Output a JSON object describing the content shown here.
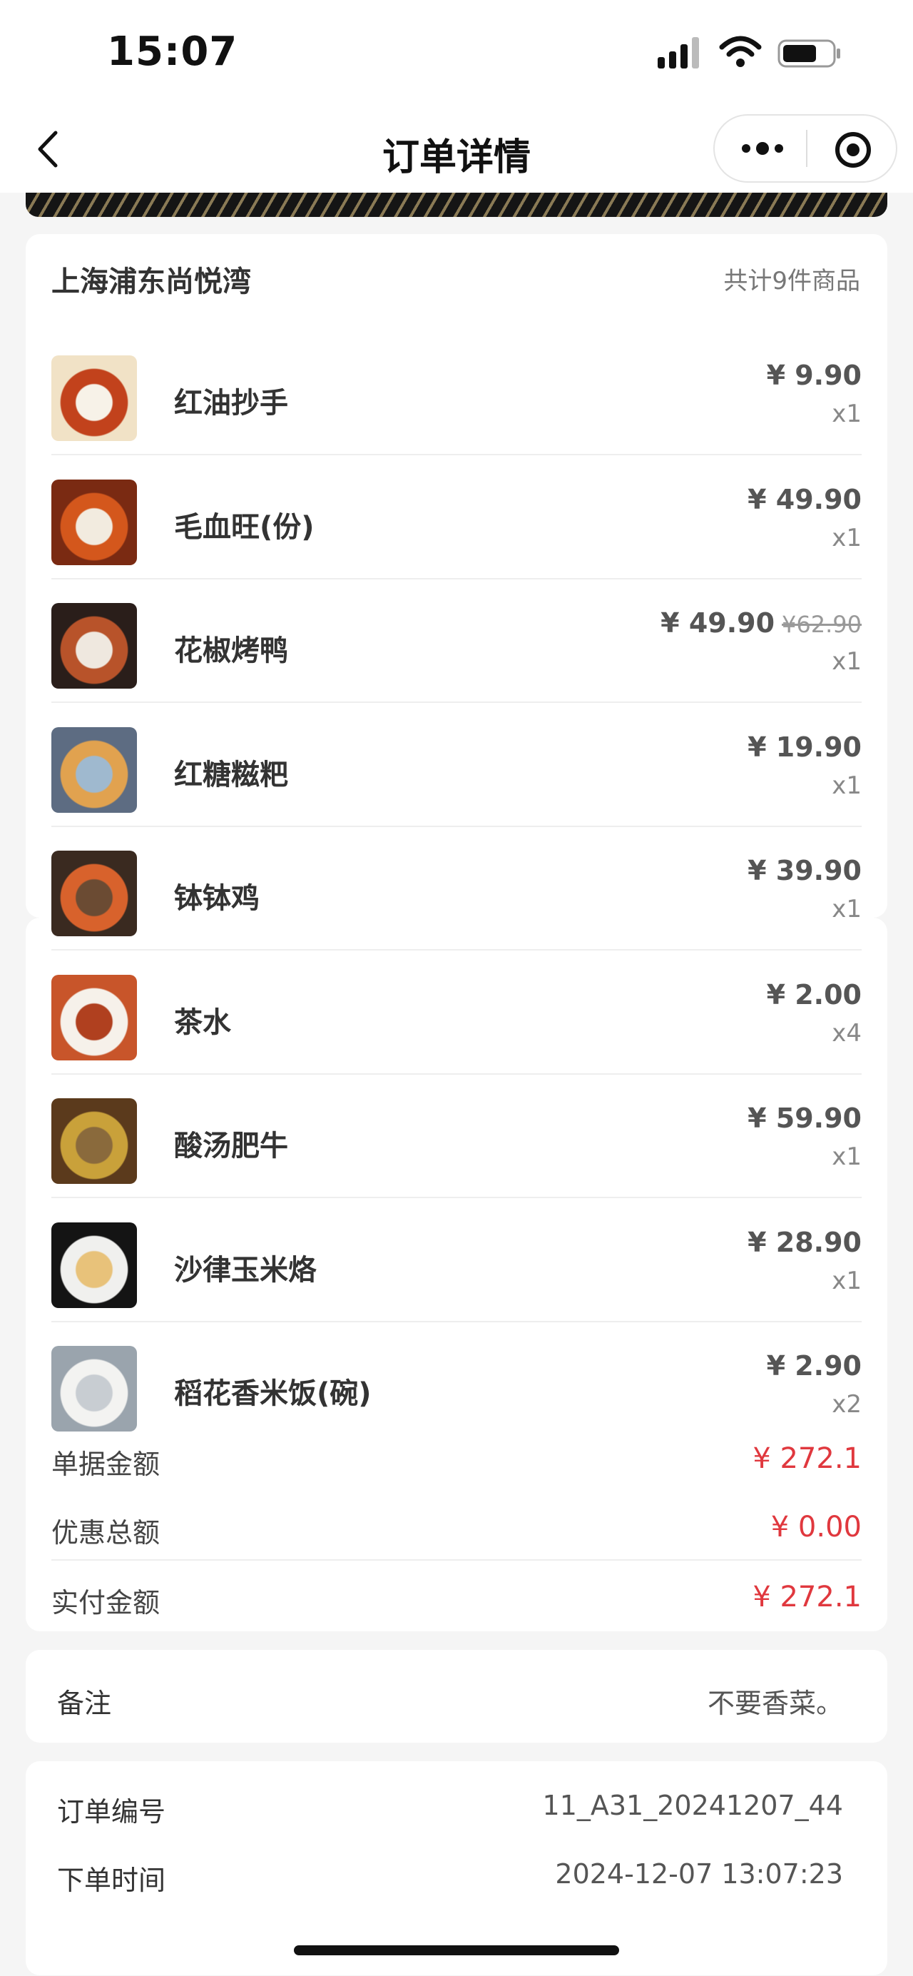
{
  "status_bar": {
    "time": "15:07"
  },
  "nav": {
    "title": "订单详情"
  },
  "order": {
    "store_name": "上海浦东尚悦湾",
    "item_count": "共计9件商品",
    "items": [
      {
        "name": "红油抄手",
        "price": "¥ 9.90",
        "orig": "",
        "qty": "x1",
        "colors": [
          "#f1e2c6",
          "#c2421c",
          "#f7f2e8"
        ]
      },
      {
        "name": "毛血旺(份)",
        "price": "¥ 49.90",
        "orig": "",
        "qty": "x1",
        "colors": [
          "#7a2a12",
          "#d4571c",
          "#f2ebdf"
        ]
      },
      {
        "name": "花椒烤鸭",
        "price": "¥ 49.90",
        "orig": "¥62.90",
        "qty": "x1",
        "colors": [
          "#2a1e1a",
          "#b8532a",
          "#efe8df"
        ]
      },
      {
        "name": "红糖糍粑",
        "price": "¥ 19.90",
        "orig": "",
        "qty": "x1",
        "colors": [
          "#5d6c82",
          "#e1a24f",
          "#9fb9cf"
        ]
      },
      {
        "name": "钵钵鸡",
        "price": "¥ 39.90",
        "orig": "",
        "qty": "x1",
        "colors": [
          "#3a2a20",
          "#d8622c",
          "#6b4b33"
        ]
      },
      {
        "name": "茶水",
        "price": "¥ 2.00",
        "orig": "",
        "qty": "x4",
        "colors": [
          "#c8552a",
          "#f6f1ea",
          "#b0401f"
        ]
      },
      {
        "name": "酸汤肥牛",
        "price": "¥ 59.90",
        "orig": "",
        "qty": "x1",
        "colors": [
          "#5b3a1c",
          "#c9a13a",
          "#8a6a3c"
        ]
      },
      {
        "name": "沙律玉米烙",
        "price": "¥ 28.90",
        "orig": "",
        "qty": "x1",
        "colors": [
          "#141414",
          "#f0f0ee",
          "#e8c27a"
        ]
      },
      {
        "name": "稻花香米饭(碗)",
        "price": "¥ 2.90",
        "orig": "",
        "qty": "x2",
        "colors": [
          "#9aa4ad",
          "#f3f3f1",
          "#c8cdd2"
        ]
      }
    ],
    "summary": [
      {
        "label": "单据金额",
        "value": "¥ 272.1"
      },
      {
        "label": "优惠总额",
        "value": "¥ 0.00"
      },
      {
        "label": "实付金额",
        "value": "¥ 272.1"
      }
    ]
  },
  "remark": {
    "label": "备注",
    "value": "不要香菜。"
  },
  "info": {
    "order_no_label": "订单编号",
    "order_no": "11_A31_20241207_44",
    "time_label": "下单时间",
    "time": "2024-12-07 13:07:23"
  }
}
